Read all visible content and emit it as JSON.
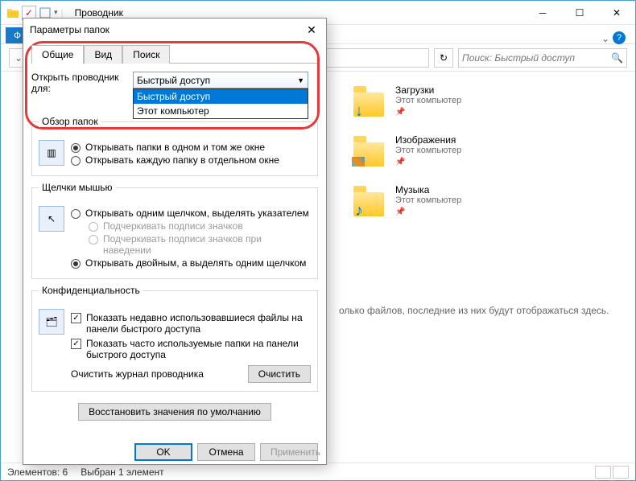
{
  "window": {
    "title": "Проводник",
    "ribbon": {
      "file": "Ф"
    },
    "search_placeholder": "Поиск: Быстрый доступ"
  },
  "folders": [
    {
      "name": "Загрузки",
      "sub": "Этот компьютер",
      "badge": "↓",
      "badge_color": "#0078d7"
    },
    {
      "name": "Изображения",
      "sub": "Этот компьютер",
      "badge": "▦",
      "badge_color": "#39a0e5"
    },
    {
      "name": "Музыка",
      "sub": "Этот компьютер",
      "badge": "♪",
      "badge_color": "#0078d7"
    }
  ],
  "panel_message": "олько файлов, последние из них будут отображаться здесь.",
  "status": {
    "count": "Элементов: 6",
    "selected": "Выбран 1 элемент"
  },
  "dialog": {
    "title": "Параметры папок",
    "tabs": {
      "general": "Общие",
      "view": "Вид",
      "search": "Поиск"
    },
    "open_for_label": "Открыть проводник для:",
    "combo_selected": "Быстрый доступ",
    "combo_options": {
      "opt1": "Быстрый доступ",
      "opt2": "Этот компьютер"
    },
    "browse": {
      "legend": "Обзор папок",
      "opt_same": "Открывать папки в одном и том же окне",
      "opt_new": "Открывать каждую папку в отдельном окне"
    },
    "clicks": {
      "legend": "Щелчки мышью",
      "opt_single": "Открывать одним щелчком, выделять указателем",
      "sub1": "Подчеркивать подписи значков",
      "sub2": "Подчеркивать подписи значков при наведении",
      "opt_double": "Открывать двойным, а выделять одним щелчком"
    },
    "privacy": {
      "legend": "Конфиденциальность",
      "chk_recent": "Показать недавно использовавшиеся файлы на панели быстрого доступа",
      "chk_freq": "Показать часто используемые папки на панели быстрого доступа",
      "clear_label": "Очистить журнал проводника",
      "clear_btn": "Очистить"
    },
    "restore": "Восстановить значения по умолчанию",
    "ok": "OK",
    "cancel": "Отмена",
    "apply": "Применить"
  }
}
